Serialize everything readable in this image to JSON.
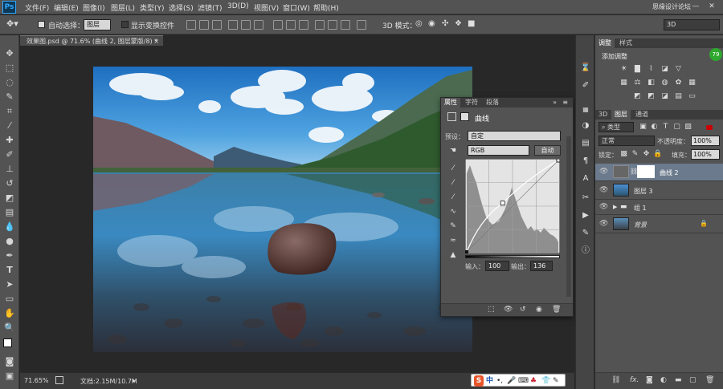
{
  "menubar": {
    "logo": "Ps",
    "items": [
      "文件(F)",
      "编辑(E)",
      "图像(I)",
      "图层(L)",
      "类型(Y)",
      "选择(S)",
      "滤镜(T)",
      "3D(D)",
      "视图(V)",
      "窗口(W)",
      "帮助(H)"
    ],
    "watermark": "思缘设计论坛",
    "minimize": "—",
    "close": "✕"
  },
  "options": {
    "auto_select_label": "自动选择：",
    "auto_select_value": "图层",
    "show_transform_label": "显示变换控件",
    "mode3d_label": "3D 模式：",
    "workspace": "3D"
  },
  "document": {
    "tab_title": "效果图.psd @ 71.6% (曲线 2, 图层蒙版/8) *",
    "close_glyph": "×",
    "zoom": "71.65%",
    "doc_info": "文档:2.15M/10.7M"
  },
  "properties": {
    "tabs": [
      "属性",
      "字符",
      "段落"
    ],
    "title": "曲线",
    "preset_label": "预设：",
    "preset_value": "自定",
    "channel": "RGB",
    "auto_button": "自动",
    "input_label": "输入：",
    "input_value": "100",
    "output_label": "输出：",
    "output_value": "136",
    "curve_point": {
      "input": 100,
      "output": 136
    }
  },
  "adjustments": {
    "tabs": [
      "调整",
      "样式"
    ],
    "title": "添加调整",
    "badge": "79"
  },
  "layers": {
    "tabs": [
      "3D",
      "图层",
      "通道"
    ],
    "filter_label": "类型",
    "blend_mode": "正常",
    "opacity_label": "不透明度：",
    "opacity_value": "100%",
    "lock_label": "锁定：",
    "fill_label": "填充：",
    "fill_value": "100%",
    "items": [
      {
        "name": "曲线 2"
      },
      {
        "name": "图层 3"
      },
      {
        "name": "组 1"
      },
      {
        "name": "背景"
      }
    ],
    "footer_fx": "fx."
  },
  "ime": {
    "brand": "S",
    "lang": "中"
  },
  "colors": {
    "accent": "#31a8ff",
    "panel": "#535353",
    "dark": "#282828"
  }
}
